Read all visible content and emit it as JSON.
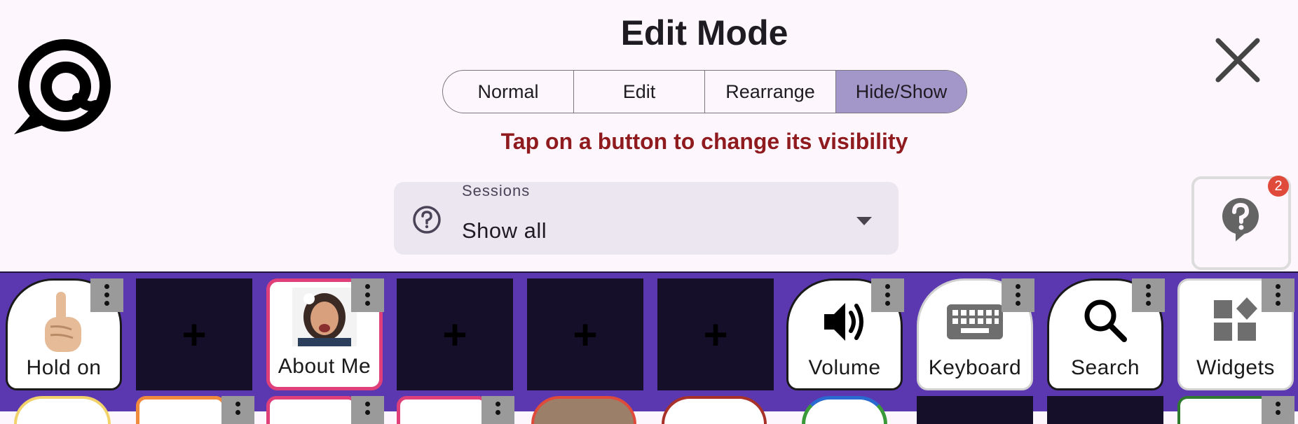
{
  "header": {
    "title": "Edit Mode",
    "hint": "Tap on a button to change its visibility"
  },
  "mode_tabs": [
    {
      "label": "Normal",
      "active": false
    },
    {
      "label": "Edit",
      "active": false
    },
    {
      "label": "Rearrange",
      "active": false
    },
    {
      "label": "Hide/Show",
      "active": true
    }
  ],
  "sessions": {
    "label": "Sessions",
    "value": "Show all"
  },
  "help": {
    "badge": "2"
  },
  "tiles": {
    "hold_on": "Hold on",
    "about_me": "About Me",
    "volume": "Volume",
    "keyboard": "Keyboard",
    "search": "Search",
    "widgets": "Widgets",
    "empty_plus": "+"
  },
  "colors": {
    "background": "#fdf7fd",
    "board": "#5b37b0",
    "active_tab": "#a396c9",
    "hint": "#8f1b1f",
    "badge": "#e04a3a",
    "empty_tile": "#150f29"
  },
  "icons": [
    "app-logo-icon",
    "close-icon",
    "question-circle-icon",
    "dropdown-caret-icon",
    "help-bubble-icon",
    "pointing-hand-icon",
    "volume-icon",
    "keyboard-icon",
    "search-icon",
    "widgets-icon",
    "more-vert-icon"
  ]
}
